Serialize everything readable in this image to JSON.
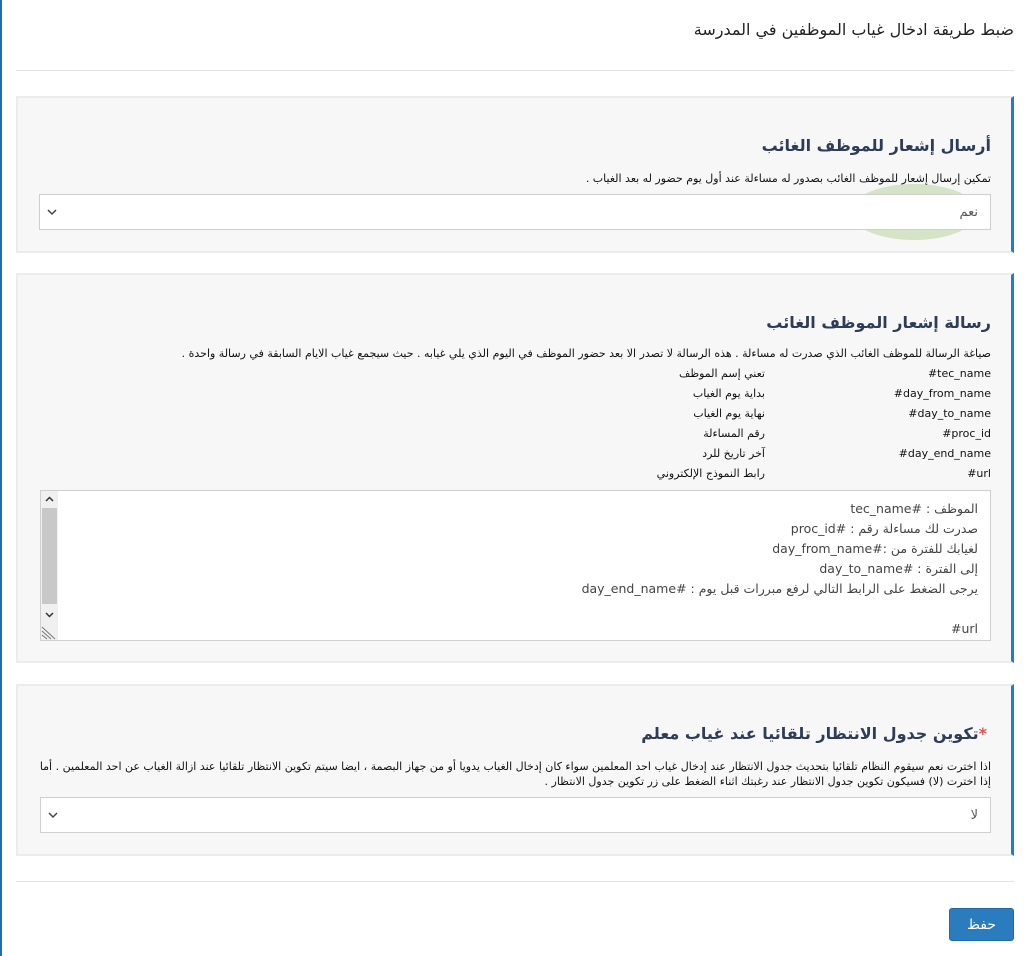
{
  "page": {
    "title": "ضبط طريقة ادخال غياب الموظفين في المدرسة"
  },
  "absence_notification": {
    "title": "أرسال إشعار للموظف الغائب",
    "help": "تمكين إرسال إشعار للموظف الغائب بصدور له مساءلة عند أول يوم حضور له بعد الغياب .",
    "selected": "نعم"
  },
  "notification_message": {
    "title": "رسالة إشعار الموظف الغائب",
    "help": "صياغة الرسالة للموظف الغائب الذي صدرت له مساءلة . هذه الرسالة لا تصدر الا بعد حضور الموظف في اليوم الذي يلي غيابه . حيث سيجمع غياب الايام السابقة في رسالة واحدة .",
    "placeholders": [
      {
        "key": "#tec_name",
        "desc": "تعني إسم الموظف"
      },
      {
        "key": "#day_from_name",
        "desc": "بداية يوم الغياب"
      },
      {
        "key": "#day_to_name",
        "desc": "نهاية يوم الغياب"
      },
      {
        "key": "#proc_id",
        "desc": "رقم المساءلة"
      },
      {
        "key": "#day_end_name",
        "desc": "آخر تاريخ للرد"
      },
      {
        "key": "#url",
        "desc": "رابط النموذج الإلكتروني"
      }
    ],
    "message_lines": [
      "الموظف : #tec_name",
      "صدرت لك مساءلة رقم : #proc_id",
      "لغيابك للفترة من :#day_from_name",
      "إلى الفترة : #day_to_name",
      "يرجى الضغط على الرابط التالي لرفع مبررات قبل يوم : #day_end_name",
      "",
      "#url"
    ]
  },
  "waiting_schedule": {
    "title": "تكوين جدول الانتظار تلقائيا عند غياب معلم",
    "required_mark": "*",
    "help": "اذا اخترت نعم سيقوم النظام تلقائيا بتحديث جدول الانتظار عند إدخال غياب احد المعلمين سواء كان إدخال الغياب يدويا أو من جهاز البصمة ، ايضا سيتم تكوين الانتظار تلقائيا عند ازالة الغياب عن احد المعلمين . أما إذا اخترت (لا) فسيكون تكوين جدول الانتظار عند رغبتك اثناء الضغط على زر تكوين جدول الانتظار .",
    "selected": "لا"
  },
  "actions": {
    "save_label": "حفظ"
  },
  "colors": {
    "accent": "#1b80c4",
    "button": "#2b7bbf",
    "required": "#d9534f"
  }
}
